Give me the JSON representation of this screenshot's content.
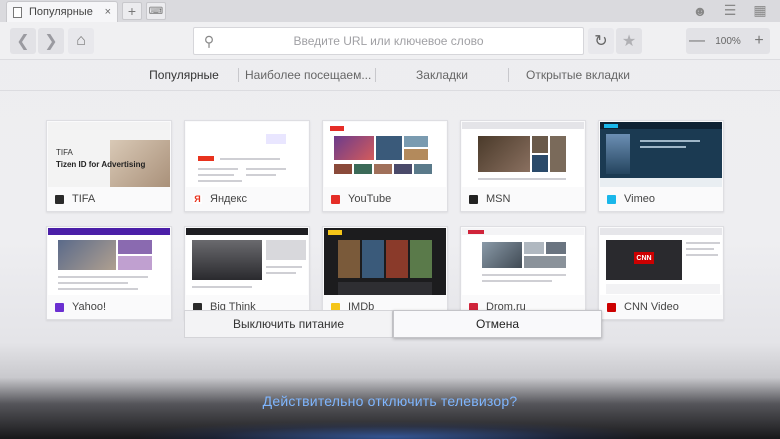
{
  "browser": {
    "tab_title": "Популярные",
    "tab_close": "×",
    "new_tab": "+",
    "url_placeholder": "Введите URL или ключевое слово",
    "zoom": "100%",
    "zoom_minus": "—",
    "zoom_plus": "+"
  },
  "categories": [
    {
      "label": "Популярные",
      "active": true
    },
    {
      "label": "Наиболее посещаем...",
      "active": false
    },
    {
      "label": "Закладки",
      "active": false
    },
    {
      "label": "Открытые вкладки",
      "active": false
    }
  ],
  "tiles": [
    {
      "label": "TIFA",
      "fav_color": "#2b2b2b",
      "thumb_title": "TIFA",
      "thumb_subtitle": "Tizen ID for Advertising"
    },
    {
      "label": "Яндекс",
      "fav_color": "#e8321d",
      "fav_glyph": "Я"
    },
    {
      "label": "YouTube",
      "fav_color": "#e52d27"
    },
    {
      "label": "MSN",
      "fav_color": "#222222"
    },
    {
      "label": "Vimeo",
      "fav_color": "#1ab7ea"
    },
    {
      "label": "Yahoo!",
      "fav_color": "#6b2fd1"
    },
    {
      "label": "Big Think",
      "fav_color": "#2b2b2b"
    },
    {
      "label": "IMDb",
      "fav_color": "#f5c518"
    },
    {
      "label": "Drom.ru",
      "fav_color": "#d0243a"
    },
    {
      "label": "CNN Video",
      "fav_color": "#cc0000",
      "thumb_logo": "CNN"
    }
  ],
  "dialog": {
    "power_off": "Выключить питание",
    "cancel": "Отмена",
    "question": "Действительно отключить телевизор?"
  }
}
